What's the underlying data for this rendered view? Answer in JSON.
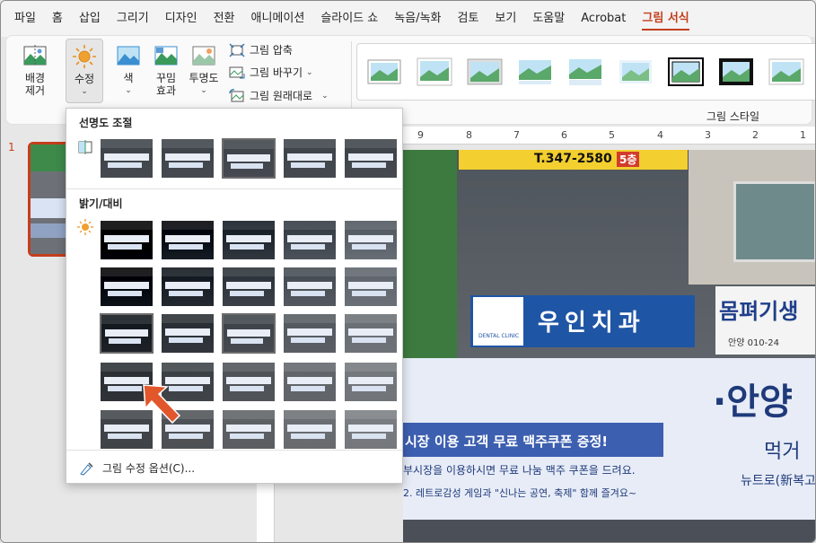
{
  "menu": {
    "tabs": [
      "파일",
      "홈",
      "삽입",
      "그리기",
      "디자인",
      "전환",
      "애니메이션",
      "슬라이드 쇼",
      "녹음/녹화",
      "검토",
      "보기",
      "도움말",
      "Acrobat",
      "그림 서식"
    ],
    "active_index": 13
  },
  "ribbon": {
    "remove_bg_line1": "배경",
    "remove_bg_line2": "제거",
    "corrections_label": "수정",
    "color_label": "색",
    "artistic_line1": "꾸밈",
    "artistic_line2": "효과",
    "transparency_label": "투명도",
    "compress_label": "그림 압축",
    "change_label": "그림 바꾸기",
    "reset_label": "그림 원래대로",
    "chevron": "⌄",
    "group_picture_styles": "그림 스타일"
  },
  "slides": {
    "current_number": "1"
  },
  "ruler": {
    "ticks": [
      "9",
      "8",
      "7",
      "6",
      "5",
      "4",
      "3",
      "2",
      "1"
    ]
  },
  "photo": {
    "sign_phone": "T.347-2580",
    "sign_floor": "5층",
    "sign_dental": "우인치과",
    "sign_dental_sub": "DENTAL CLINIC",
    "sign_right": "몸펴기생",
    "sign_right_phone": "안양 010-24",
    "banner_hello": "·안양",
    "banner_line1": "시장 이용 고객 무료 맥주쿠폰 증정!",
    "banner_line2": "부시장을 이용하시면 무료 나눔 맥주 쿠폰을 드려요.",
    "banner_line3": "2. 레트로감성 게임과 \"신나는 공연, 축제\" 함께 즐겨요~",
    "banner_right1": "먹거",
    "banner_right2": "뉴트로(新복고)"
  },
  "dropdown": {
    "sharpness_heading": "선명도 조절",
    "brightness_heading": "밝기/대비",
    "options_label": "그림 수정 옵션(C)..."
  },
  "colors": {
    "accent": "#c43e1c",
    "ribbon_bg": "#fafafa",
    "menu_bg": "#f3f3f3"
  }
}
